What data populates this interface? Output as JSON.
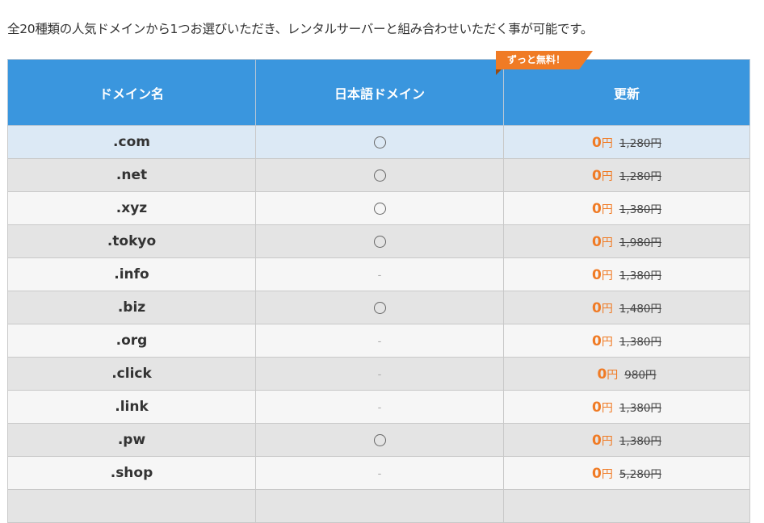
{
  "intro_text": "全20種類の人気ドメインから1つお選びいただき、レンタルサーバーと組み合わせいただく事が可能です。",
  "badge": {
    "label": "ずっと無料！",
    "color": "#f07b25"
  },
  "colors": {
    "header_bg": "#3a96de",
    "accent_price": "#f07b25",
    "highlight_row": "#dce9f5"
  },
  "table": {
    "headers": [
      "ドメイン名",
      "日本語ドメイン",
      "更新"
    ],
    "rows": [
      {
        "domain": ".com",
        "japanese": "circle",
        "japanese_text": "〇",
        "price": "0",
        "yen": "円",
        "old_price": "1,280円"
      },
      {
        "domain": ".net",
        "japanese": "circle",
        "japanese_text": "〇",
        "price": "0",
        "yen": "円",
        "old_price": "1,280円"
      },
      {
        "domain": ".xyz",
        "japanese": "circle",
        "japanese_text": "〇",
        "price": "0",
        "yen": "円",
        "old_price": "1,380円"
      },
      {
        "domain": ".tokyo",
        "japanese": "circle",
        "japanese_text": "〇",
        "price": "0",
        "yen": "円",
        "old_price": "1,980円"
      },
      {
        "domain": ".info",
        "japanese": "dash",
        "japanese_text": "-",
        "price": "0",
        "yen": "円",
        "old_price": "1,380円"
      },
      {
        "domain": ".biz",
        "japanese": "circle",
        "japanese_text": "〇",
        "price": "0",
        "yen": "円",
        "old_price": "1,480円"
      },
      {
        "domain": ".org",
        "japanese": "dash",
        "japanese_text": "-",
        "price": "0",
        "yen": "円",
        "old_price": "1,380円"
      },
      {
        "domain": ".click",
        "japanese": "dash",
        "japanese_text": "-",
        "price": "0",
        "yen": "円",
        "old_price": "980円"
      },
      {
        "domain": ".link",
        "japanese": "dash",
        "japanese_text": "-",
        "price": "0",
        "yen": "円",
        "old_price": "1,380円"
      },
      {
        "domain": ".pw",
        "japanese": "circle",
        "japanese_text": "〇",
        "price": "0",
        "yen": "円",
        "old_price": "1,380円"
      },
      {
        "domain": ".shop",
        "japanese": "dash",
        "japanese_text": "-",
        "price": "0",
        "yen": "円",
        "old_price": "5,280円"
      },
      {
        "domain": "",
        "japanese": "",
        "japanese_text": "",
        "price": "",
        "yen": "",
        "old_price": ""
      }
    ]
  }
}
